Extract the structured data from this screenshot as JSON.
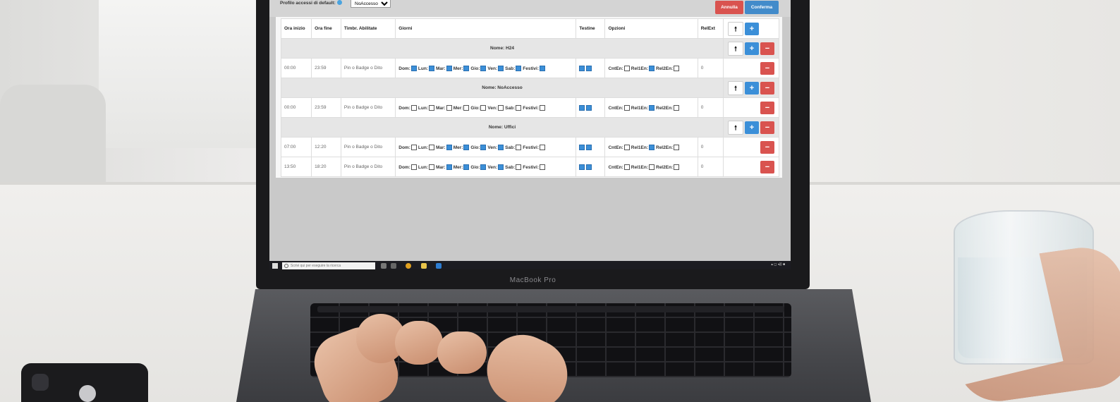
{
  "app": {
    "default_profile_label": "Profilo accessi di default:",
    "default_profile_value": "NoAccesso",
    "cancel_label": "Annulla",
    "confirm_label": "Conferma"
  },
  "table": {
    "headers": [
      "Ora inizio",
      "Ora fine",
      "Timbr. Abilitate",
      "Giorni",
      "Testine",
      "Opzioni",
      "RelExt"
    ],
    "groups": [
      {
        "name": "Nome: H24",
        "rows": [
          {
            "start": "00:00",
            "end": "23:59",
            "mode": "Pin o Badge o Dito",
            "days": [
              true,
              true,
              true,
              true,
              true,
              true,
              true,
              true
            ],
            "heads": [
              true,
              true
            ],
            "options": [
              false,
              true,
              false
            ],
            "relext": "0"
          }
        ]
      },
      {
        "name": "Nome: NoAccesso",
        "rows": [
          {
            "start": "00:00",
            "end": "23:59",
            "mode": "Pin o Badge o Dito",
            "days": [
              false,
              false,
              false,
              false,
              false,
              false,
              false,
              false
            ],
            "heads": [
              true,
              true
            ],
            "options": [
              false,
              true,
              false
            ],
            "relext": "0"
          }
        ]
      },
      {
        "name": "Nome: Uffici",
        "rows": [
          {
            "start": "07:00",
            "end": "12:20",
            "mode": "Pin o Badge o Dito",
            "days": [
              false,
              false,
              true,
              true,
              true,
              true,
              false,
              false
            ],
            "heads": [
              true,
              true
            ],
            "options": [
              false,
              true,
              false
            ],
            "relext": "0"
          },
          {
            "start": "13:50",
            "end": "18:20",
            "mode": "Pin o Badge o Dito",
            "days": [
              false,
              false,
              true,
              true,
              true,
              true,
              false,
              false
            ],
            "heads": [
              true,
              true
            ],
            "options": [
              false,
              false,
              false
            ],
            "relext": "0"
          }
        ]
      }
    ],
    "day_labels": [
      "Dom:",
      "Lun:",
      "Mar:",
      "Mer:",
      "Gio:",
      "Ven:",
      "Sab:",
      "Festivi:"
    ],
    "option_labels": [
      "CntEn:",
      "Rel1En:",
      "Rel2En:"
    ]
  },
  "taskbar": {
    "search_placeholder": "Scrivi qui per eseguire la ricerca"
  },
  "laptop": {
    "brand": "MacBook Pro"
  },
  "colors": {
    "accent_blue": "#3b8fd8",
    "danger_red": "#d9534f"
  }
}
